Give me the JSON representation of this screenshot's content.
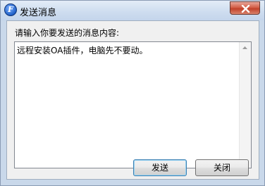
{
  "window": {
    "title": "发送消息",
    "app_icon_letter": "F",
    "close_icon": "close-x-icon",
    "accent": "#c9d8ea"
  },
  "dialog": {
    "prompt": "请输入你要发送的消息内容:",
    "message_value": "远程安装OA插件，电脑先不要动。",
    "send_label": "发送",
    "close_label": "关闭"
  }
}
